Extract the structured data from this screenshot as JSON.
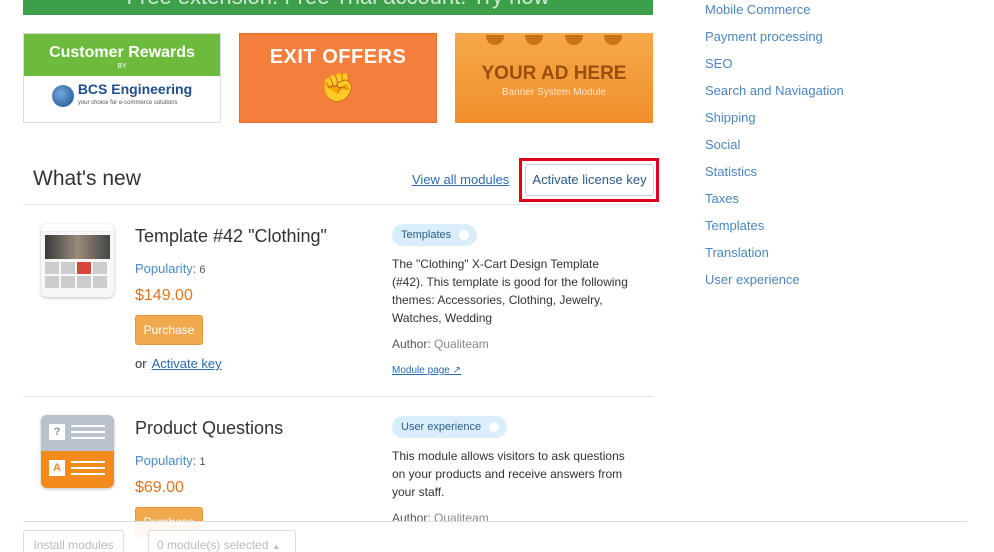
{
  "top_banner": {
    "text": "Free extension. Free Trial account. Try now"
  },
  "ads": {
    "rewards": {
      "title": "Customer Rewards",
      "by": "BY",
      "company": "BCS Engineering",
      "tagline": "your choice for e-commerce solutions"
    },
    "exit": {
      "title": "EXIT OFFERS"
    },
    "your_ad": {
      "title": "YOUR AD HERE",
      "subtitle": "Banner System Module"
    }
  },
  "whats_new": {
    "title": "What's new",
    "view_all": "View all modules",
    "activate_license": "Activate license key"
  },
  "modules": [
    {
      "name": "Template #42 \"Clothing\"",
      "popularity_label": "Popularity:",
      "popularity": "6",
      "price": "$149.00",
      "purchase": "Purchase",
      "or": "or",
      "activate_key": "Activate key",
      "tag": "Templates",
      "description": "The \"Clothing\" X-Cart Design Template (#42). This template is good for the following themes: Accessories, Clothing, Jewelry, Watches, Wedding",
      "author_label": "Author:",
      "author": "Qualiteam",
      "module_page": "Module page"
    },
    {
      "name": "Product Questions",
      "popularity_label": "Popularity:",
      "popularity": "1",
      "price": "$69.00",
      "purchase": "Purchase",
      "tag": "User experience",
      "description": "This module allows visitors to ask questions on your products and receive answers from your staff.",
      "author_label": "Author:",
      "author": "Qualiteam"
    }
  ],
  "bottom": {
    "install": "Install modules",
    "selected": "0 module(s) selected"
  },
  "categories": [
    "Mobile Commerce",
    "Payment processing",
    "SEO",
    "Search and Naviagation",
    "Shipping",
    "Social",
    "Statistics",
    "Taxes",
    "Templates",
    "Translation",
    "User experience"
  ]
}
